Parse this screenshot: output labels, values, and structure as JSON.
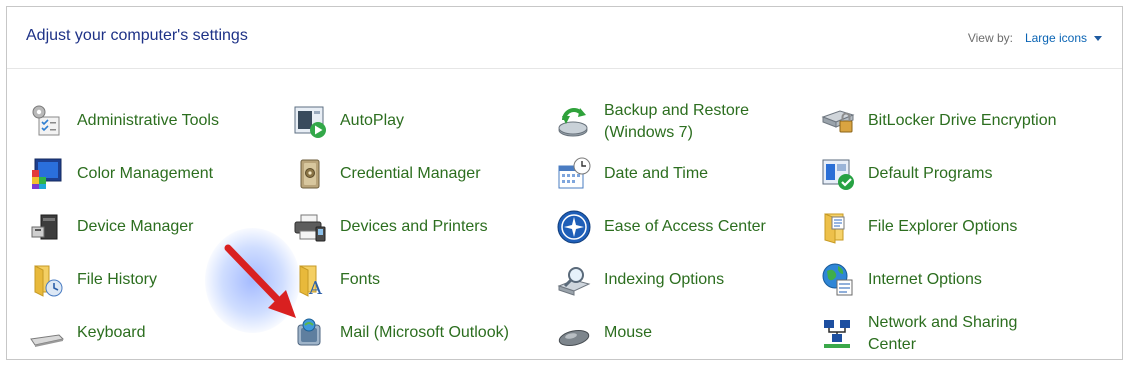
{
  "header": {
    "title": "Adjust your computer's settings",
    "view_by_label": "View by:",
    "view_by_value": "Large icons"
  },
  "colors": {
    "title": "#1e3287",
    "link": "#2c6e1f",
    "viewby_value": "#0a64b4",
    "arrow": "#d92020"
  },
  "items": [
    {
      "label": "Administrative Tools",
      "icon": "administrative-tools-icon"
    },
    {
      "label": "AutoPlay",
      "icon": "autoplay-icon"
    },
    {
      "label": "Backup and Restore",
      "label2": "(Windows 7)",
      "icon": "backup-restore-icon"
    },
    {
      "label": "BitLocker Drive Encryption",
      "icon": "bitlocker-icon"
    },
    {
      "label": "Color Management",
      "icon": "color-management-icon"
    },
    {
      "label": "Credential Manager",
      "icon": "credential-manager-icon"
    },
    {
      "label": "Date and Time",
      "icon": "date-time-icon"
    },
    {
      "label": "Default Programs",
      "icon": "default-programs-icon"
    },
    {
      "label": "Device Manager",
      "icon": "device-manager-icon"
    },
    {
      "label": "Devices and Printers",
      "icon": "devices-printers-icon"
    },
    {
      "label": "Ease of Access Center",
      "icon": "ease-of-access-icon"
    },
    {
      "label": "File Explorer Options",
      "icon": "file-explorer-options-icon"
    },
    {
      "label": "File History",
      "icon": "file-history-icon"
    },
    {
      "label": "Fonts",
      "icon": "fonts-icon"
    },
    {
      "label": "Indexing Options",
      "icon": "indexing-options-icon"
    },
    {
      "label": "Internet Options",
      "icon": "internet-options-icon"
    },
    {
      "label": "Keyboard",
      "icon": "keyboard-icon"
    },
    {
      "label": "Mail (Microsoft Outlook)",
      "icon": "mail-icon"
    },
    {
      "label": "Mouse",
      "icon": "mouse-icon"
    },
    {
      "label": "Network and Sharing",
      "label2": "Center",
      "icon": "network-sharing-icon"
    }
  ]
}
